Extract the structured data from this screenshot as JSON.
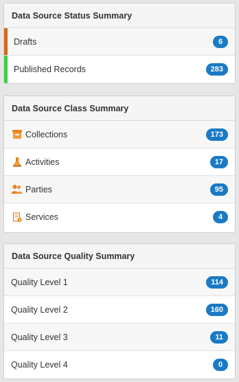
{
  "status_summary": {
    "title": "Data Source Status Summary",
    "items": [
      {
        "label": "Drafts",
        "count": "6",
        "indicator_color": "#d5661c"
      },
      {
        "label": "Published Records",
        "count": "283",
        "indicator_color": "#44cc44"
      }
    ]
  },
  "class_summary": {
    "title": "Data Source Class Summary",
    "items": [
      {
        "label": "Collections",
        "count": "173",
        "icon": "collections-icon"
      },
      {
        "label": "Activities",
        "count": "17",
        "icon": "activities-icon"
      },
      {
        "label": "Parties",
        "count": "95",
        "icon": "parties-icon"
      },
      {
        "label": "Services",
        "count": "4",
        "icon": "services-icon"
      }
    ]
  },
  "quality_summary": {
    "title": "Data Source Quality Summary",
    "items": [
      {
        "label": "Quality Level 1",
        "count": "114"
      },
      {
        "label": "Quality Level 2",
        "count": "160"
      },
      {
        "label": "Quality Level 3",
        "count": "11"
      },
      {
        "label": "Quality Level 4",
        "count": "0"
      }
    ]
  },
  "colors": {
    "badge": "#1a7ac5",
    "icon_orange": "#e8821e"
  }
}
